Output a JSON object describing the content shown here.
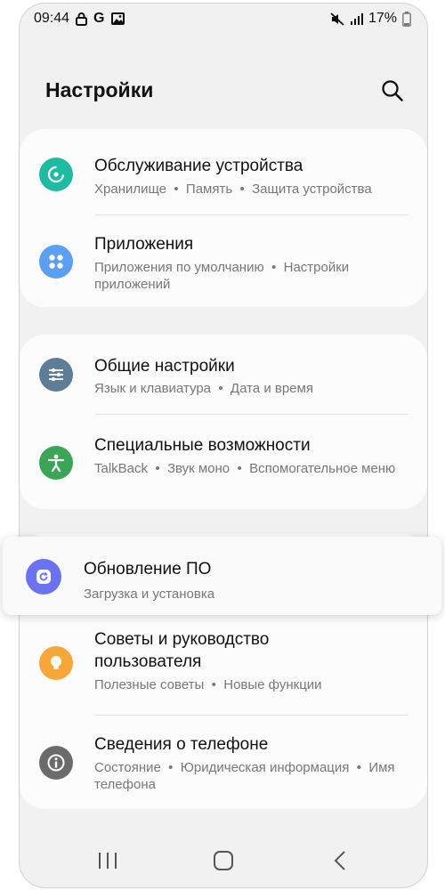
{
  "status_bar": {
    "time": "09:44",
    "left_icons": [
      "lock-icon",
      "google-icon",
      "image-icon"
    ],
    "google_glyph": "G",
    "battery": "17%",
    "right_icons": [
      "mute-icon",
      "signal-icon",
      "battery-icon"
    ]
  },
  "header": {
    "title": "Настройки",
    "search_icon": "search-icon"
  },
  "items": [
    {
      "title": "Обслуживание устройства",
      "subtitle": "Хранилище  •  Память  •  Защита устройства",
      "icon": "device-care-icon",
      "color": "#1fbaa2"
    },
    {
      "title": "Приложения",
      "subtitle": "Приложения по умолчанию  •  Настройки приложений",
      "icon": "apps-icon",
      "color": "#5b9ff3"
    },
    {
      "title": "Общие настройки",
      "subtitle": "Язык и клавиатура  •  Дата и время",
      "icon": "sliders-icon",
      "color": "#5d7e96"
    },
    {
      "title": "Специальные возможности",
      "subtitle": "TalkBack  •  Звук моно  •  Вспомогательное меню",
      "icon": "accessibility-icon",
      "color": "#3aa557"
    },
    {
      "title": "Обновление ПО",
      "subtitle": "Загрузка и установка",
      "icon": "software-update-icon",
      "color": "#6b72f0"
    },
    {
      "title": "Советы и руководство пользователя",
      "subtitle": "Полезные советы  •  Новые функции",
      "icon": "tips-icon",
      "color": "#f7a73a"
    },
    {
      "title": "Сведения о телефоне",
      "subtitle": "Состояние  •  Юридическая информация  •  Имя телефона",
      "icon": "info-icon",
      "color": "#6b6b6b"
    }
  ],
  "nav": {
    "recents_icon": "recents-icon",
    "home_icon": "home-icon",
    "back_icon": "back-icon"
  }
}
